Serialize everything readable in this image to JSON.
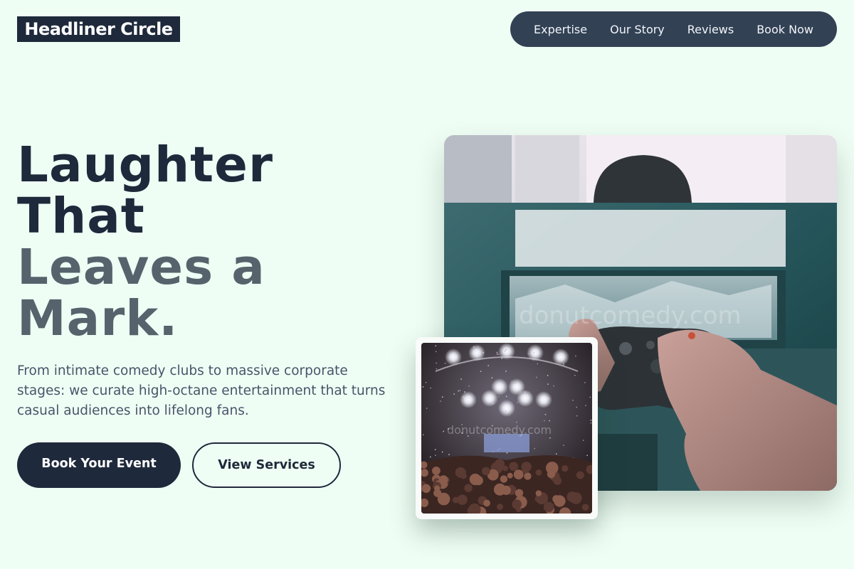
{
  "header": {
    "brand": "Headliner Circle",
    "nav": [
      "Expertise",
      "Our Story",
      "Reviews",
      "Book Now"
    ]
  },
  "hero": {
    "headline_dark_line1": "Laughter",
    "headline_dark_line2": "That",
    "headline_muted_line1": "Leaves a",
    "headline_muted_line2": "Mark.",
    "lede": "From intimate comedy clubs to massive corporate stages: we curate high-octane entertainment that turns casual audiences into lifelong fans.",
    "primary_cta": "Book Your Event",
    "secondary_cta": "View Services"
  },
  "images": {
    "main": {
      "subject": "hand holding a game controller in front of a screen",
      "watermark": "donutcomedy.com"
    },
    "inset": {
      "subject": "concert crowd under stage lights with confetti",
      "watermark": "donutcomedy.com"
    }
  },
  "colors": {
    "background": "#effef4",
    "primary": "#1e293b",
    "nav_bg": "#334155",
    "muted_heading": "#56636c",
    "body_text": "#475569"
  }
}
